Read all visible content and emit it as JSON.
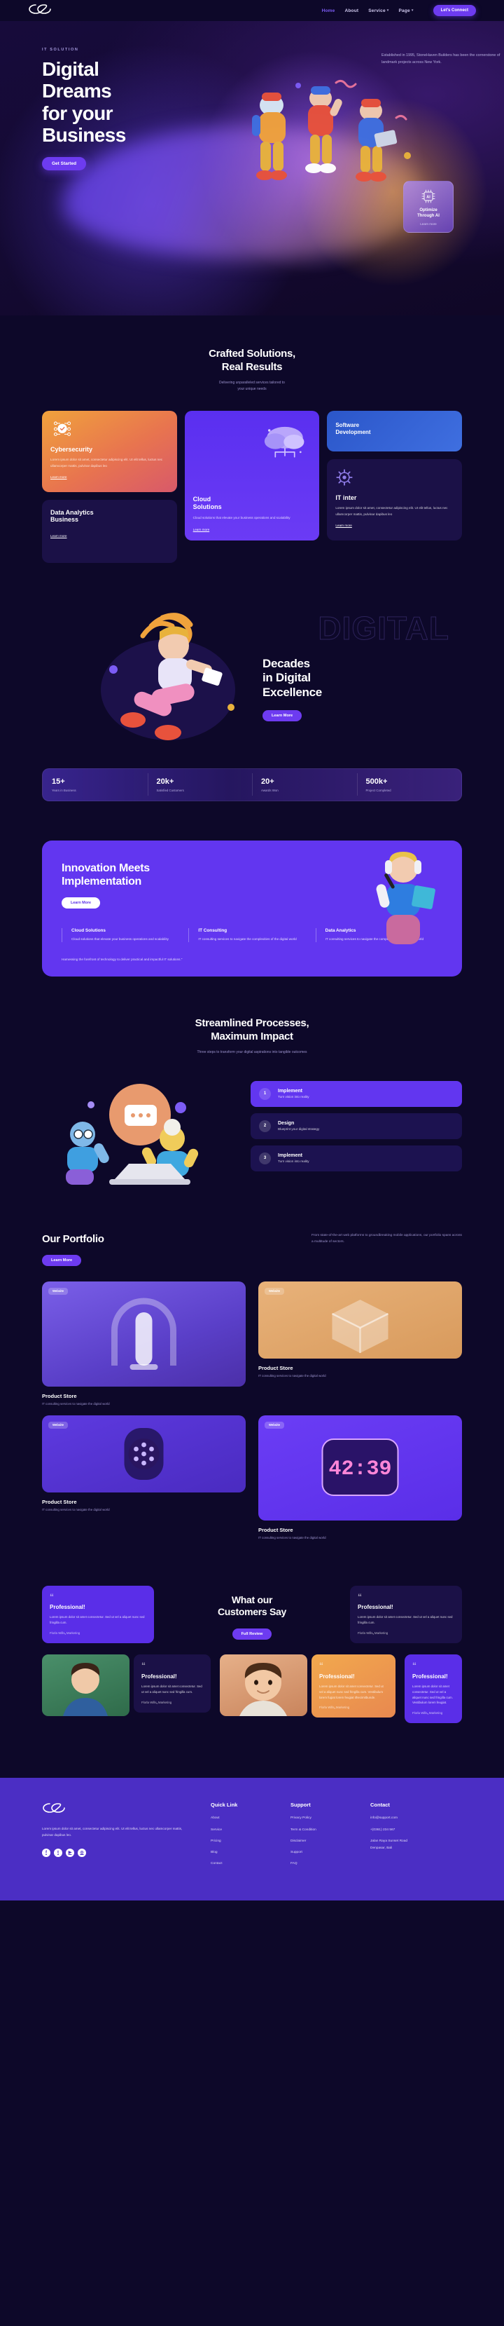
{
  "header": {
    "logo": "infinity-logo",
    "nav": [
      {
        "label": "Home",
        "active": true,
        "caret": false
      },
      {
        "label": "About",
        "active": false,
        "caret": false
      },
      {
        "label": "Service",
        "active": false,
        "caret": true
      },
      {
        "label": "Page",
        "active": false,
        "caret": true
      }
    ],
    "cta": "Let's Connect"
  },
  "hero": {
    "eyebrow": "IT SOLUTION",
    "title_l1": "Digital",
    "title_l2": "Dreams",
    "title_l3": "for your",
    "title_l4": "Business",
    "right_text": "Established in 1995, StoneHaven Builders has been the cornerstone of landmark projects across New York.",
    "cta": "Get Started",
    "ai_card": {
      "icon": "ai-chip-icon",
      "title_l1": "Optimize",
      "title_l2": "Through AI",
      "sub": "Learn more"
    }
  },
  "services": {
    "title_l1": "Crafted Solutions,",
    "title_l2": "Real Results",
    "subtitle_l1": "Delivering unparalleled services tailored to",
    "subtitle_l2": "your unique needs",
    "learn_more": "Learn more",
    "cards": [
      {
        "key": "cybersecurity",
        "title": "Cybersecurity",
        "body": "Lorem ipsum dolor sit amet, consectetur adipiscing elit. Ut elit tellus, luctus nec ullamcorper mattis, pulvinar dapibus leo",
        "icon": "shield-network-icon"
      },
      {
        "key": "data-analytics",
        "title_l1": "Data Analytics",
        "title_l2": "Business",
        "body": "",
        "icon": ""
      },
      {
        "key": "cloud-solutions",
        "title_l1": "Cloud",
        "title_l2": "Solutions",
        "body": "Cloud solutions that elevate your business operations and scalability",
        "icon": "cloud-icon"
      },
      {
        "key": "software-development",
        "title_l1": "Software",
        "title_l2": "Development",
        "body": "",
        "icon": ""
      },
      {
        "key": "it-inter",
        "title": "IT inter",
        "body": "Lorem ipsum dolor sit amet, consectetur adipiscing elit. Ut elit tellus, luctus nec ullamcorper mattis, pulvinar dapibus leo",
        "icon": "gear-icon"
      }
    ]
  },
  "decades": {
    "ghost_word": "DIGITAL",
    "title_l1": "Decades",
    "title_l2": "in Digital",
    "title_l3": "Excellence",
    "cta": "Learn More"
  },
  "stats": [
    {
      "number": "15+",
      "label": "Years in Business"
    },
    {
      "number": "20k+",
      "label": "Satisfied Customers"
    },
    {
      "number": "20+",
      "label": "Awards Won"
    },
    {
      "number": "500k+",
      "label": "Project Completed"
    }
  ],
  "innovation": {
    "title_l1": "Innovation Meets",
    "title_l2": "Implementation",
    "cta": "Learn More",
    "columns": [
      {
        "title": "Cloud Solutions",
        "body": "Cloud solutions that elevate your business operations and scalability"
      },
      {
        "title": "IT Consulting",
        "body": "IT consulting services to navigate the complexities of the digital world"
      },
      {
        "title": "Data Analytics",
        "body": "IT consulting services to navigate the complexities of the digital world"
      }
    ],
    "footer_note": "Harnessing the forefront of technology to deliver practical and impactful IT solutions.\""
  },
  "process": {
    "title_l1": "Streamlined Processes,",
    "title_l2": "Maximum Impact",
    "subtitle": "Three steps to transform your digital aspirations into tangible outcomes",
    "steps": [
      {
        "n": "1",
        "title": "Implement",
        "desc": "Turn vision into reality",
        "active": true
      },
      {
        "n": "2",
        "title": "Design",
        "desc": "Blueprint your digital strategy",
        "active": false
      },
      {
        "n": "3",
        "title": "Implement",
        "desc": "Turn vision into reality",
        "active": false
      }
    ]
  },
  "portfolio": {
    "title": "Our Portfolio",
    "intro": "From state-of-the-art web platforms to groundbreaking mobile applications, our portfolio spans across a multitude of sectors.",
    "cta": "Learn More",
    "badge": "Website",
    "items": [
      {
        "title": "Product Store",
        "desc": "IT consulting services to navigate the digital world",
        "thumb": "t-lamp",
        "tall": true
      },
      {
        "title": "Product Store",
        "desc": "IT consulting services to navigate the digital world",
        "thumb": "t-box",
        "tall": false
      },
      {
        "title": "Product Store",
        "desc": "IT consulting services to navigate the digital world",
        "thumb": "t-watch",
        "tall": false
      },
      {
        "title": "Product Store",
        "desc": "IT consulting services to navigate the digital world",
        "thumb": "t-clock",
        "tall": true
      }
    ]
  },
  "testimonials": {
    "title_l1": "What our",
    "title_l2": "Customers Say",
    "cta": "Full Review",
    "quote_mark": "“",
    "top": [
      {
        "heading": "Professional!",
        "body": "Lorem ipsum dolor sit amet consectetur. Sed ut vel a aliquet nunc sed fringilla cum.",
        "name": "Florla Wills",
        "role": "Marketing",
        "style": "t-purple"
      },
      {
        "heading": "Professional!",
        "body": "Lorem ipsum dolor sit amet consectetur. Sed ut vel a aliquet nunc sed fringilla cum.",
        "name": "Florla Wills",
        "role": "Marketing",
        "style": "t-dark"
      }
    ],
    "bottom": [
      {
        "heading": "Professional!",
        "body": "Lorem ipsum dolor sit amet consectetur. Sed ut vel a aliquet nunc sed fringilla cum.",
        "name": "Florla Wills",
        "role": "Marketing",
        "style": "t-dark"
      },
      {
        "heading": "Professional!",
        "body": "Lorem ipsum dolor sit amet consectetur. Sed ut vel a aliquet nunc sed fringilla cum. Vestibulum lorem fugiat lorem feugiat ithecimitbunde.",
        "name": "Florla Wills",
        "role": "Marketing",
        "style": "t-orange"
      },
      {
        "heading": "Professional!",
        "body": "Lorem ipsum dolor sit amet consectetur. Sed ut vel a aliquet nunc sed fringilla cum. Vestibulum lorem feugiat.",
        "name": "Florla Wills",
        "role": "Marketing",
        "style": "t-purple"
      }
    ]
  },
  "footer": {
    "logo": "infinity-logo",
    "about": "Lorem ipsum dolor sit amet, consectetur adipiscing elit. Ut elit tellus, luctus nec ullamcorper mattis, pulvinar dapibus leo.",
    "socials": [
      "facebook-icon",
      "twitter-icon",
      "youtube-icon",
      "instagram-icon"
    ],
    "columns": [
      {
        "title": "Quick Link",
        "links": [
          "About",
          "Service",
          "Pricing",
          "Blog",
          "Contact"
        ]
      },
      {
        "title": "Support",
        "links": [
          "Privacy Policy",
          "Term & Condition",
          "Disclaimer",
          "Support",
          "FAQ"
        ]
      }
    ],
    "contact": {
      "title": "Contact",
      "email": "info@support.com",
      "phone": "+(0361) 234 567",
      "address_l1": "Jalan Raya Sunset Road",
      "address_l2": "Denpasar, Bali"
    }
  },
  "colors": {
    "bg": "#0d0829",
    "accent": "#6236f0",
    "accent_light": "#7c5cf5",
    "card_dark": "#1b1147",
    "orange": "#e8884f",
    "blue": "#3f6fe0",
    "footer": "#4b2ec4"
  }
}
